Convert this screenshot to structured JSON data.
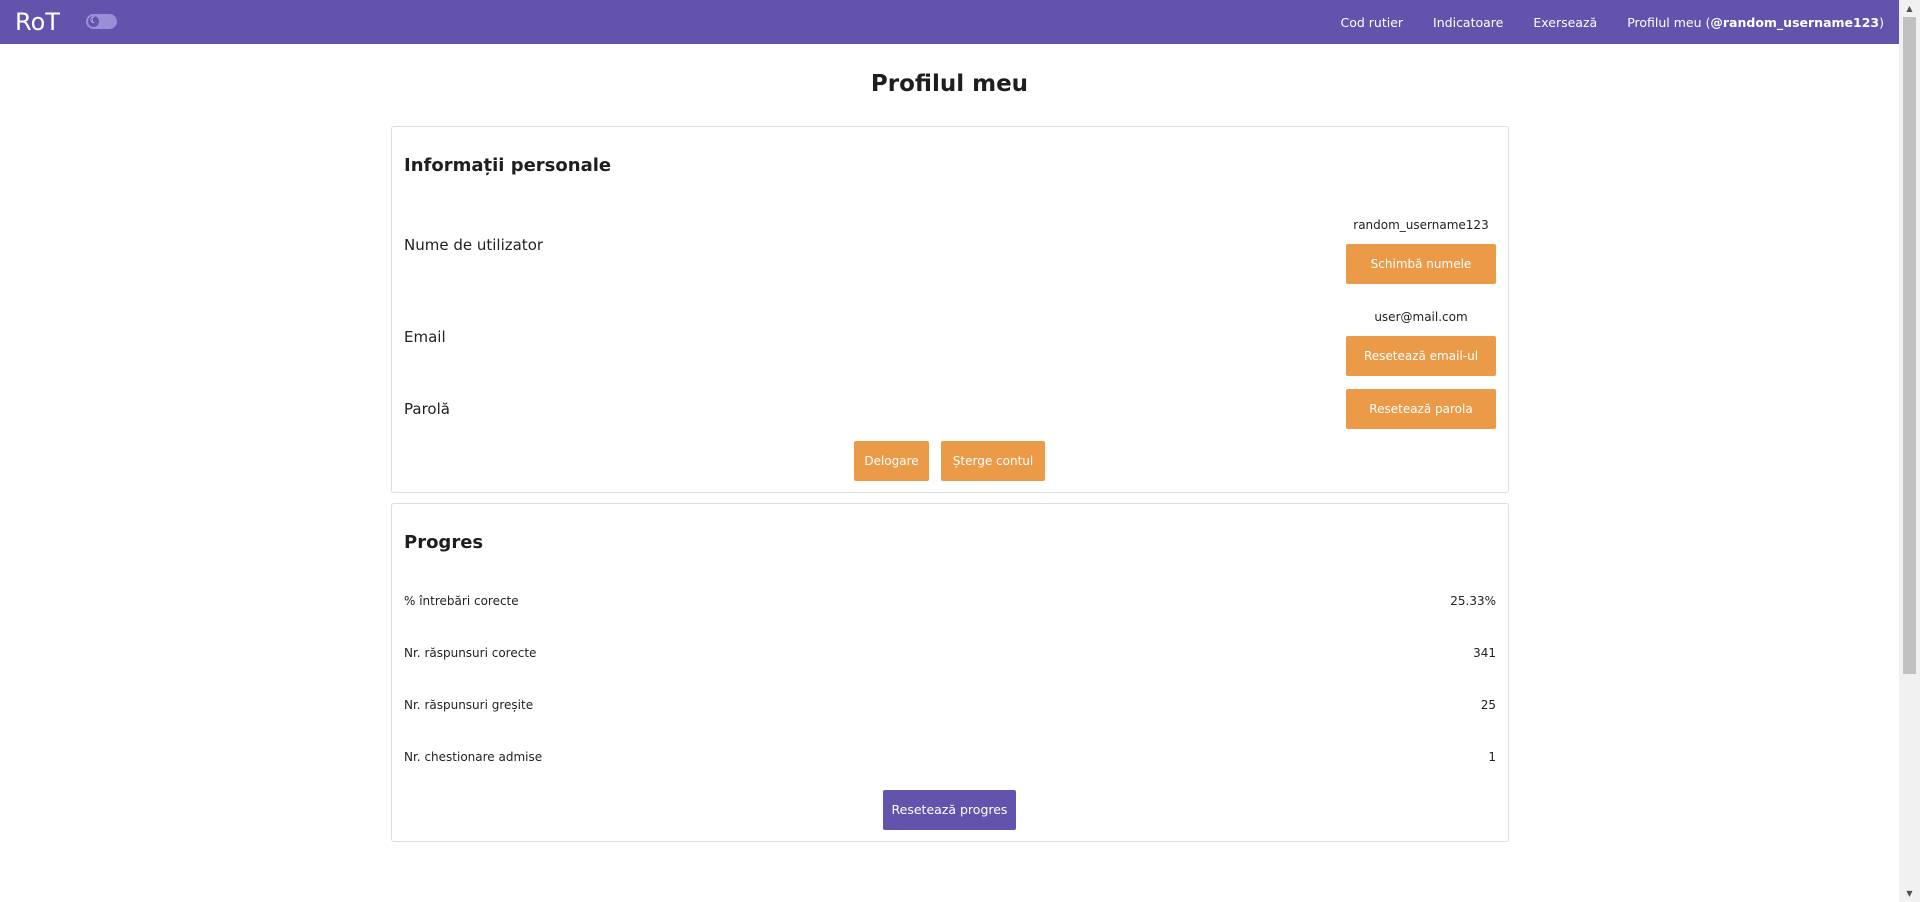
{
  "navbar": {
    "brand": "RoT",
    "theme_icon": "moon-icon",
    "links": {
      "road_code": "Cod rutier",
      "signs": "Indicatoare",
      "practice": "Exersează",
      "profile_prefix": "Profilul meu (",
      "profile_user": "@random_username123",
      "profile_suffix": ")"
    }
  },
  "page": {
    "title": "Profilul meu"
  },
  "personal_info": {
    "title": "Informații personale",
    "username_label": "Nume de utilizator",
    "username_value": "random_username123",
    "change_name_button": "Schimbă numele",
    "email_label": "Email",
    "email_value": "user@mail.com",
    "reset_email_button": "Resetează email-ul",
    "password_label": "Parolă",
    "reset_password_button": "Resetează parola",
    "logout_button": "Delogare",
    "delete_account_button": "Șterge contul"
  },
  "progress": {
    "title": "Progres",
    "stats": [
      {
        "label": "% întrebări corecte",
        "value": "25.33%"
      },
      {
        "label": "Nr. răspunsuri corecte",
        "value": "341"
      },
      {
        "label": "Nr. răspunsuri greșite",
        "value": "25"
      },
      {
        "label": "Nr. chestionare admise",
        "value": "1"
      }
    ],
    "reset_button": "Resetează progres"
  },
  "colors": {
    "primary": "#6353ad",
    "accent": "#eb9a48"
  }
}
